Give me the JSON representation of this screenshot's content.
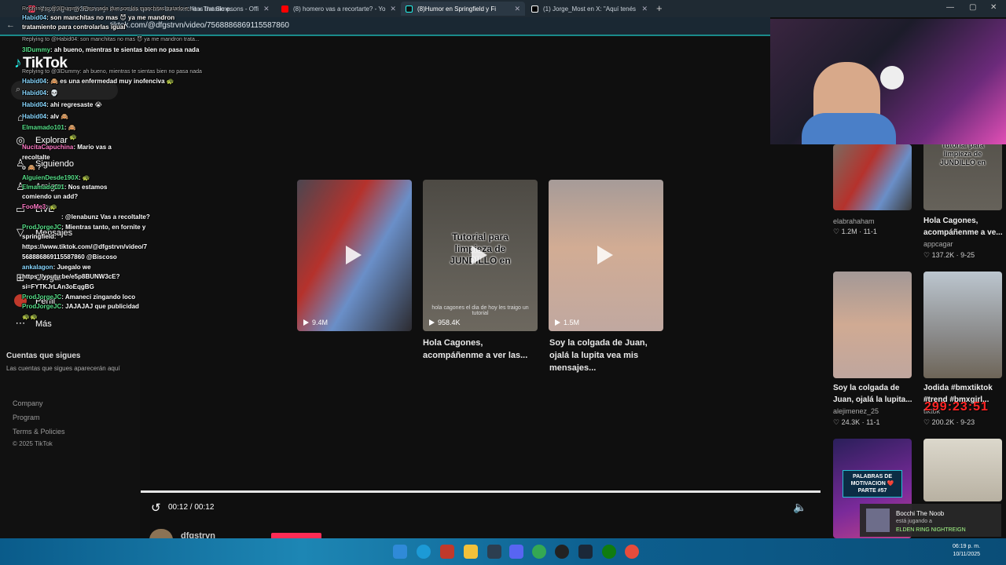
{
  "browser": {
    "tabs": [
      {
        "label": "Replying to @3lDummy: Pero nada que son las manchitas tratarlo e...",
        "active": false
      },
      {
        "label": "le x The Simpsons - Offi",
        "active": false
      },
      {
        "label": "(8) homero vas a recortarte? - Yo",
        "active": false
      },
      {
        "label": "(8)Humor en Springfield y Fi",
        "active": true
      },
      {
        "label": "(1) Jorge_Most en X: \"Aquí tenés",
        "active": false
      }
    ],
    "url": "tiktok.com/@dfgstrvn/video/7568886869115587860"
  },
  "sidebar": {
    "logo": "TikTok",
    "nav": [
      {
        "label": "Explorar",
        "icon": "compass-icon"
      },
      {
        "label": "Siguiendo",
        "icon": "user-icon"
      },
      {
        "label": "Amigos",
        "icon": "friends-icon"
      },
      {
        "label": "LIVE",
        "icon": "live-icon"
      },
      {
        "label": "Mensajes",
        "icon": "message-icon"
      },
      {
        "label": "Cargar",
        "icon": "upload-icon"
      },
      {
        "label": "Perfil",
        "icon": "profile-icon"
      },
      {
        "label": "Más",
        "icon": "more-icon"
      }
    ],
    "following_title": "Cuentas que sigues",
    "following_sub": "Las cuentas que sigues aparecerán aquí",
    "footer": [
      "Company",
      "Program",
      "Terms & Policies",
      "© 2025 TikTok"
    ]
  },
  "chat": [
    {
      "reply": "Replying to @3lDummy: Pero nada que son las manchitas tratarlo e...",
      "user": "",
      "text": ""
    },
    {
      "reply": "",
      "user": "Habid04",
      "text": ": son manchitas no mas 😈 ya me mandron"
    },
    {
      "reply": "",
      "user": "",
      "text": "tratamiento para controlarlas igual"
    },
    {
      "reply": "Replying to @Habid04: son manchitas no mas 😈 ya me mandron trata...",
      "user": "",
      "text": ""
    },
    {
      "reply": "",
      "user": "3lDummy",
      "text": ": ah bueno, mientras te sientas bien no pasa nada"
    },
    {
      "reply": "Replying to @3lDummy: ah bueno, mientras te sientas bien no pasa nada",
      "user": "",
      "text": ""
    },
    {
      "reply": "",
      "user": "Habid04",
      "text": ": 🙈 es una enfermedad muy inofenciva 🐢"
    },
    {
      "reply": "",
      "user": "Habid04",
      "text": ": 💀"
    },
    {
      "reply": "",
      "user": "Habid04",
      "text": ": ahi regresaste 😭"
    },
    {
      "reply": "",
      "user": "Habid04",
      "text": ": alv 🙈"
    },
    {
      "reply": "",
      "user": "Elmamado101",
      "text": ": 🙈"
    },
    {
      "reply": "",
      "user": "",
      "text": "🐢"
    },
    {
      "reply": "",
      "user": "NucitaCapuchina",
      "text": ": Mario vas a"
    },
    {
      "reply": "",
      "user": "",
      "text": "recoltalte"
    },
    {
      "reply": "",
      "user": "",
      "text": "o 🙈 ?"
    },
    {
      "reply": "",
      "user": "AlguienDesde190X",
      "text": ": 🐢"
    },
    {
      "reply": "",
      "user": "Elmamado101",
      "text": ": Nos estamos"
    },
    {
      "reply": "",
      "user": "",
      "text": "comiendo un add?"
    },
    {
      "reply": "",
      "user": "FooMe3",
      "text": ": 🐢"
    },
    {
      "reply": "",
      "user": "",
      "text": ": @lenabunz Vas a recoltalte?"
    },
    {
      "reply": "",
      "user": "ProdJorgeJC",
      "text": ": Mientras tanto, en fornite y"
    },
    {
      "reply": "",
      "user": "",
      "text": "springfield:"
    },
    {
      "reply": "",
      "user": "",
      "text": "https://www.tiktok.com/@dfgstrvn/video/7"
    },
    {
      "reply": "",
      "user": "",
      "text": "568886869115587860 @Biscoso"
    },
    {
      "reply": "",
      "user": "ankalagon",
      "text": ": Juegalo we"
    },
    {
      "reply": "",
      "user": "",
      "text": "https://youtu.be/e5p8BUNW3cE?"
    },
    {
      "reply": "",
      "user": "",
      "text": "si=FYTKJrLAn3oEqgBG"
    },
    {
      "reply": "",
      "user": "ProdJorgeJC",
      "text": ": Amaneci zingando loco"
    },
    {
      "reply": "",
      "user": "ProdJorgeJC",
      "text": ": JAJAJAJ que publicidad"
    },
    {
      "reply": "",
      "user": "",
      "text": "🐢🐢"
    }
  ],
  "videos": [
    {
      "views": "9.4M",
      "title": "",
      "colors": [
        "#3d3a40",
        "#b5322c",
        "#5a7db5"
      ]
    },
    {
      "views": "958.4K",
      "title": "Hola Cagones, acompáñenme a ver las...",
      "overlay": "Tutorial para limpieza de JUNDILLO en",
      "caption": "hola cagones el dia de hoy les traigo un tutorial",
      "colors": [
        "#4a4741",
        "#5d5a53",
        "#7a756c"
      ]
    },
    {
      "views": "1.5M",
      "title": "Soy la colgada de Juan, ojalá la lupita vea mis mensajes...",
      "colors": [
        "#9b8f8d",
        "#cda690",
        "#b8a49e"
      ]
    }
  ],
  "player": {
    "time": "00:12 / 00:12",
    "progress": 1.0,
    "author": "dfgstrvn"
  },
  "related": [
    {
      "author": "elabrahaham",
      "title": "",
      "likes": "1.2M",
      "date": "11-1"
    },
    {
      "author": "appcagar",
      "title": "Hola Cagones, acompáñenme a ve...",
      "likes": "137.2K",
      "date": "9-25",
      "overlay": "Tutorial para limpieza de JUNDILLO en"
    },
    {
      "author": "alejimenez_25",
      "title": "Soy la colgada de Juan, ojalá la lupita...",
      "likes": "24.3K",
      "date": "11-1"
    },
    {
      "author": "tiktok",
      "title": "Jodida #bmxtiktok #trend #bmxgirl...",
      "likes": "200.2K",
      "date": "9-23"
    },
    {
      "overlay": "PALABRAS DE MOTIVACION ❤️ PARTE #57"
    },
    {}
  ],
  "timer": "299:23:51",
  "notification": {
    "name": "Bocchi The Noob",
    "sub": "está jugando a",
    "game": "ELDEN RING NIGHTREIGN"
  },
  "clock": {
    "time": "06:19 p. m.",
    "date": "10/11/2025"
  }
}
